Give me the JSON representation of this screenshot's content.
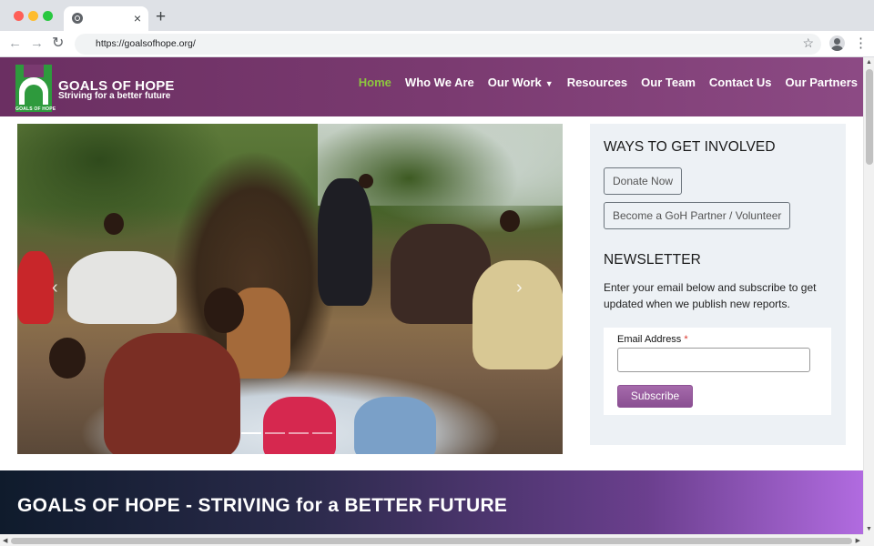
{
  "browser": {
    "tab_close": "×",
    "new_tab": "+",
    "back": "←",
    "forward": "→",
    "reload": "↻",
    "url": "https://goalsofhope.org/",
    "star": "☆",
    "menu": "⋮"
  },
  "site": {
    "logo_small_text": "GOALS OF HOPE",
    "brand_title": "GOALS OF HOPE",
    "brand_subtitle": "Striving for a better future",
    "colors": {
      "header": "#7a3a70",
      "nav_active": "#8dc63f",
      "logo_green": "#2e9a3d",
      "subscribe": "#9b5fa2"
    },
    "nav": [
      {
        "label": "Home",
        "active": true
      },
      {
        "label": "Who We Are"
      },
      {
        "label": "Our Work",
        "dropdown": true
      },
      {
        "label": "Resources"
      },
      {
        "label": "Our Team"
      },
      {
        "label": "Contact Us"
      },
      {
        "label": "Our Partners"
      }
    ]
  },
  "carousel": {
    "prev": "‹",
    "next": "›",
    "slide_count": 4,
    "active_slide": 1
  },
  "sidebar": {
    "involved_heading": "WAYS TO GET INVOLVED",
    "donate_label": "Donate Now",
    "partner_label": "Become a GoH Partner / Volunteer",
    "newsletter_heading": "NEWSLETTER",
    "newsletter_text": "Enter your email below and subscribe to get updated when we publish new reports.",
    "email_label": "Email Address",
    "required_marker": "*",
    "email_value": "",
    "subscribe_label": "Subscribe"
  },
  "banner": {
    "text": "GOALS OF HOPE - STRIVING for a BETTER FUTURE"
  }
}
